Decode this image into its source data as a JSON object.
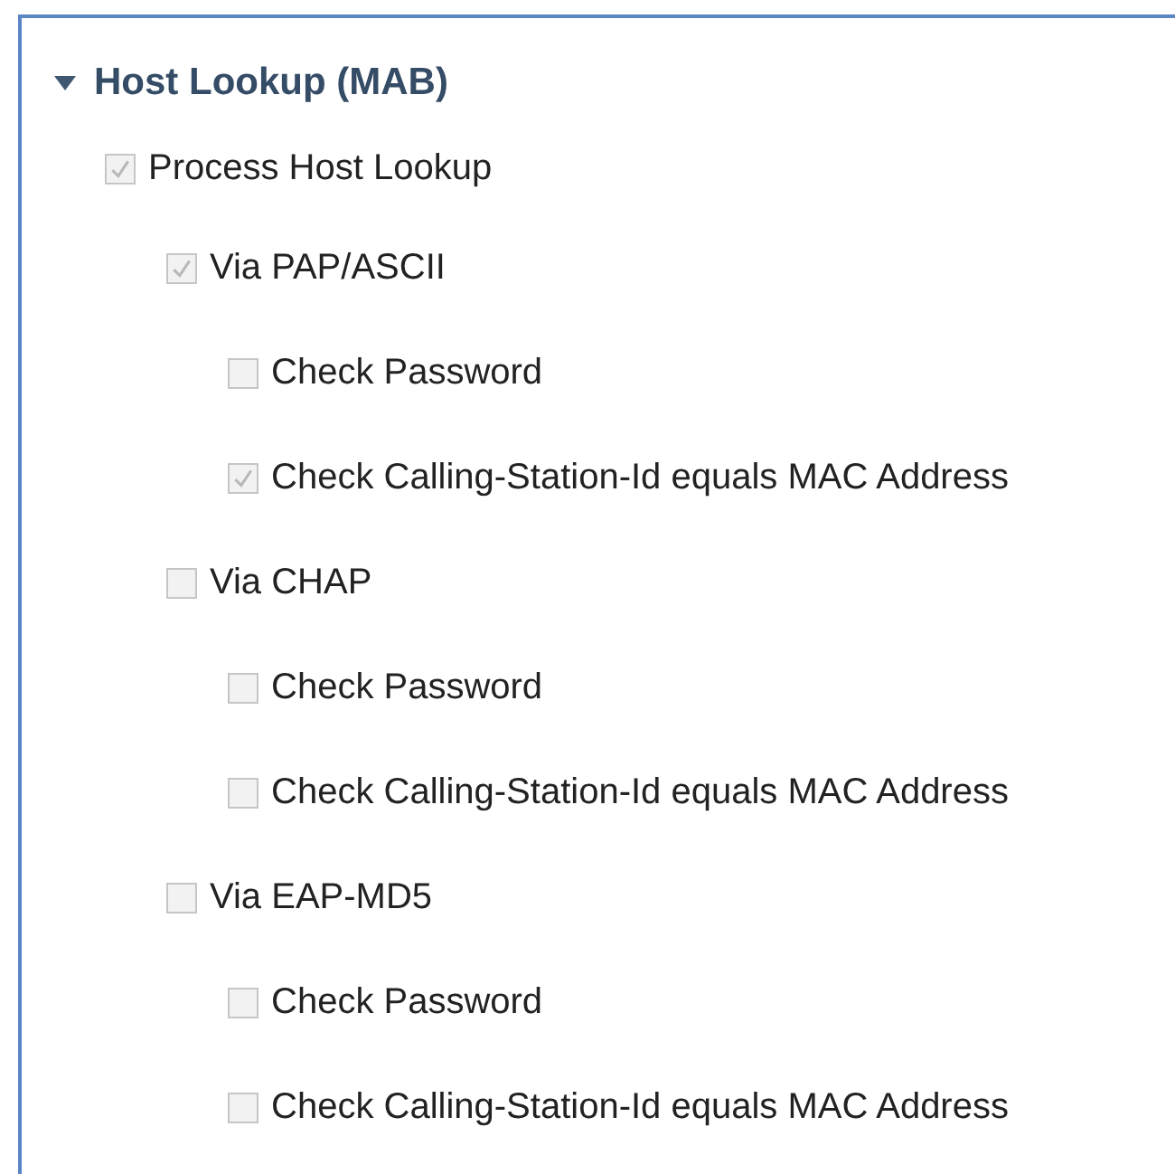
{
  "section": {
    "title": "Host Lookup (MAB)",
    "expanded": true,
    "options": [
      {
        "label": "Process Host Lookup",
        "checked": true,
        "disabled": true,
        "children": [
          {
            "label": "Via PAP/ASCII",
            "checked": true,
            "disabled": true,
            "children": [
              {
                "label": "Check Password",
                "checked": false,
                "disabled": true
              },
              {
                "label": "Check Calling-Station-Id equals MAC Address",
                "checked": true,
                "disabled": true
              }
            ]
          },
          {
            "label": "Via CHAP",
            "checked": false,
            "disabled": true,
            "children": [
              {
                "label": "Check Password",
                "checked": false,
                "disabled": true
              },
              {
                "label": "Check Calling-Station-Id equals MAC Address",
                "checked": false,
                "disabled": true
              }
            ]
          },
          {
            "label": "Via EAP-MD5",
            "checked": false,
            "disabled": true,
            "children": [
              {
                "label": "Check Password",
                "checked": false,
                "disabled": true
              },
              {
                "label": "Check Calling-Station-Id equals MAC Address",
                "checked": false,
                "disabled": true
              }
            ]
          }
        ]
      }
    ]
  }
}
